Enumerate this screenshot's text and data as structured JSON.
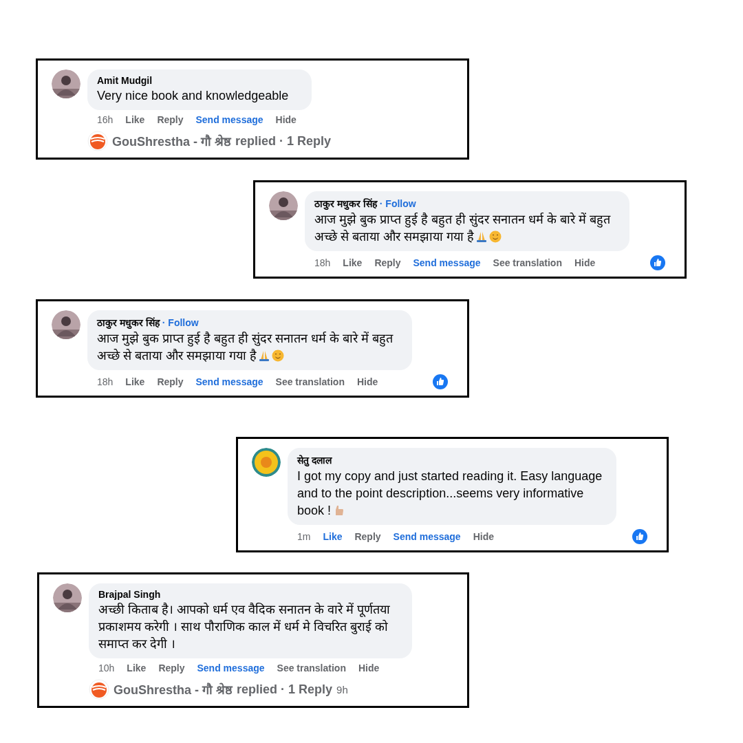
{
  "comments": [
    {
      "author": "Amit Mudgil",
      "avatar": {
        "kind": "picture"
      },
      "text": "Very nice book and knowledgeable",
      "time": "16h",
      "liked": false,
      "reacted": false,
      "actions": [
        {
          "kind": "like",
          "label": "Like"
        },
        {
          "kind": "reply",
          "label": "Reply"
        },
        {
          "kind": "message",
          "label": "Send message"
        },
        {
          "kind": "hide",
          "label": "Hide"
        }
      ],
      "replies": {
        "name": "GouShrestha - गौ श्रेष्ठ",
        "text": "replied · 1 Reply"
      }
    },
    {
      "author": "ठाकुर मधुकर सिंह",
      "follow": "· Follow",
      "avatar": {
        "kind": "picture"
      },
      "text": "आज मुझे बुक प्राप्त हुई है बहुत ही सुंदर सनातन धर्म के बारे में बहुत अच्छे से बताया और समझाया गया है",
      "emoji": [
        {
          "kind": "pray"
        },
        {
          "kind": "smile"
        }
      ],
      "time": "18h",
      "liked": false,
      "reacted": true,
      "actions": [
        {
          "kind": "like",
          "label": "Like"
        },
        {
          "kind": "reply",
          "label": "Reply"
        },
        {
          "kind": "message",
          "label": "Send message"
        },
        {
          "kind": "translate",
          "label": "See translation"
        },
        {
          "kind": "hide",
          "label": "Hide"
        }
      ]
    },
    {
      "author": "ठाकुर मधुकर सिंह",
      "follow": "· Follow",
      "avatar": {
        "kind": "picture"
      },
      "text": "आज मुझे बुक प्राप्त हुई है बहुत ही सुंदर सनातन धर्म के बारे में बहुत अच्छे से बताया और समझाया गया है",
      "emoji": [
        {
          "kind": "pray"
        },
        {
          "kind": "smile"
        }
      ],
      "time": "18h",
      "liked": false,
      "reacted": true,
      "actions": [
        {
          "kind": "like",
          "label": "Like"
        },
        {
          "kind": "reply",
          "label": "Reply"
        },
        {
          "kind": "message",
          "label": "Send message"
        },
        {
          "kind": "translate",
          "label": "See translation"
        },
        {
          "kind": "hide",
          "label": "Hide"
        }
      ]
    },
    {
      "author": "सेतु दलाल",
      "avatar": {
        "kind": "picture"
      },
      "text": "I got my copy and just started reading it. Easy language and to the point description...seems very informative book !",
      "emoji": [
        {
          "kind": "thumb"
        }
      ],
      "time": "1m",
      "liked": true,
      "reacted": true,
      "actions": [
        {
          "kind": "like",
          "label": "Like"
        },
        {
          "kind": "reply",
          "label": "Reply"
        },
        {
          "kind": "message",
          "label": "Send message"
        },
        {
          "kind": "hide",
          "label": "Hide"
        }
      ]
    },
    {
      "author": "Brajpal Singh",
      "avatar": {
        "kind": "picture"
      },
      "text": "अच्छी किताब है। आपको धर्म एव वैदिक सनातन के वारे में पूर्णतया प्रकाशमय करेगी । साथ पौराणिक काल में धर्म मे विचरित बुराई को समाप्त कर देगी ।",
      "time": "10h",
      "liked": false,
      "reacted": false,
      "actions": [
        {
          "kind": "like",
          "label": "Like"
        },
        {
          "kind": "reply",
          "label": "Reply"
        },
        {
          "kind": "message",
          "label": "Send message"
        },
        {
          "kind": "translate",
          "label": "See translation"
        },
        {
          "kind": "hide",
          "label": "Hide"
        }
      ],
      "replies": {
        "name": "GouShrestha - गौ श्रेष्ठ",
        "text": "replied · 1 Reply",
        "time": "9h"
      }
    }
  ]
}
